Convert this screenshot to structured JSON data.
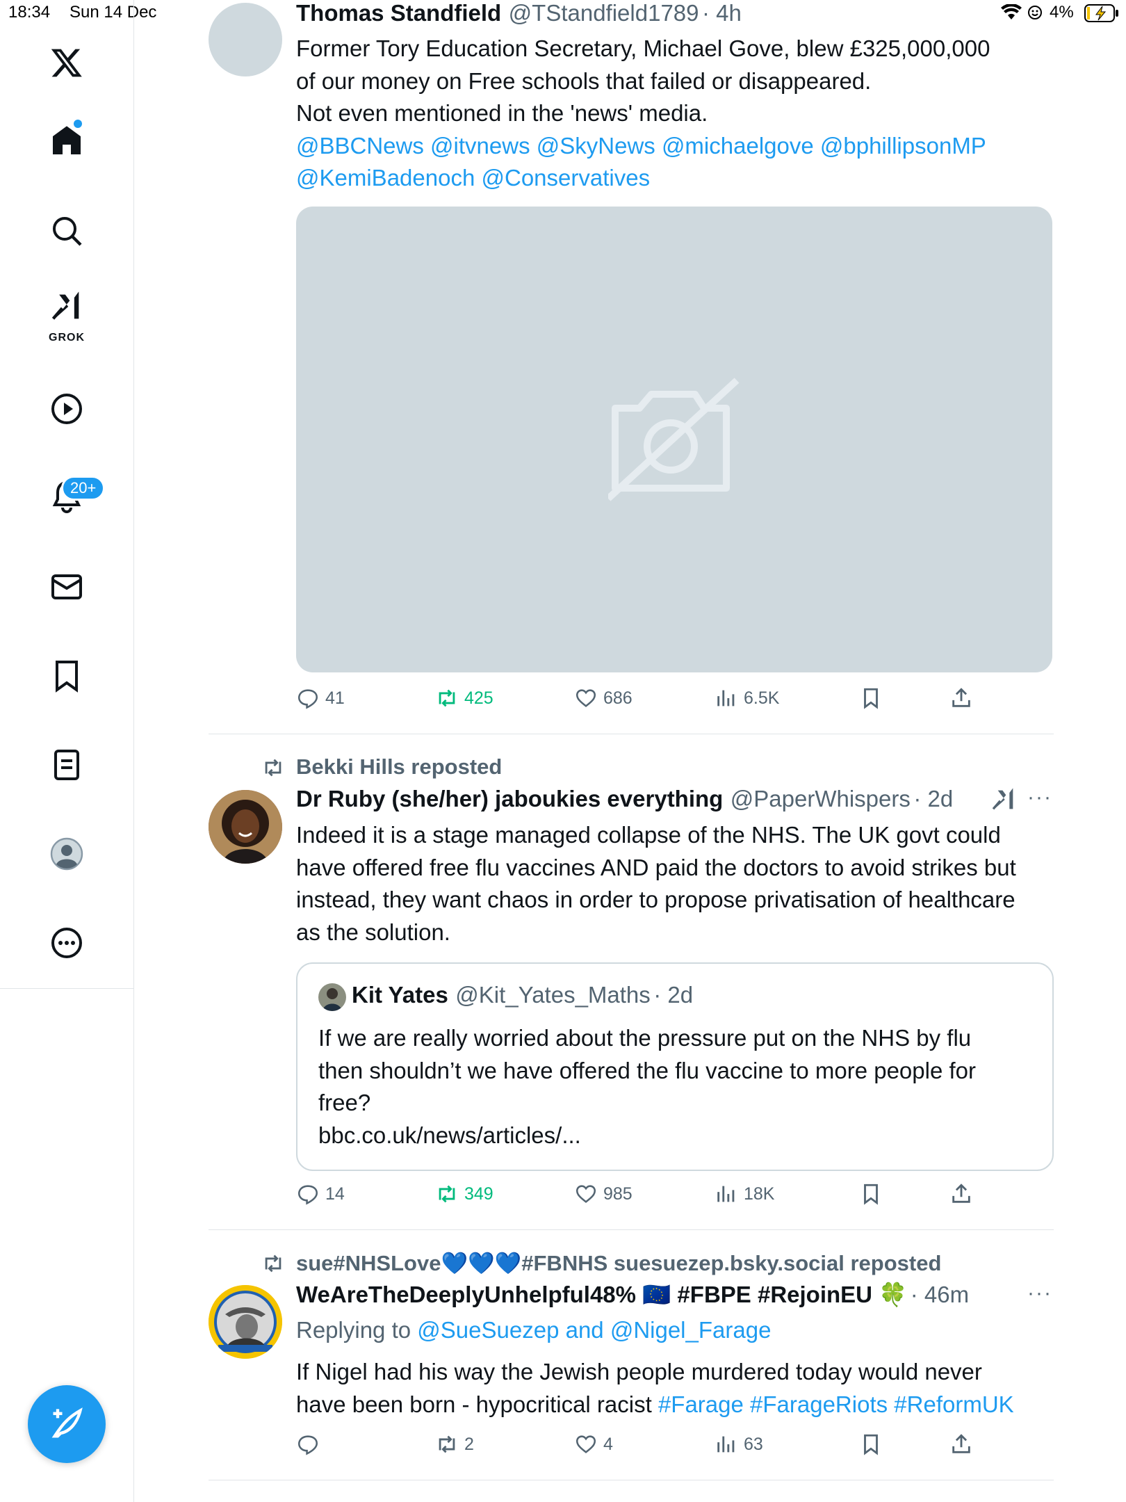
{
  "status_bar": {
    "time": "18:34",
    "date": "Sun 14 Dec",
    "battery": "4%"
  },
  "sidebar": {
    "grok_label": "GROK",
    "notifications_badge": "20+"
  },
  "tweets": [
    {
      "author": "Thomas Standfield",
      "handle": "@TStandfield1789",
      "time": "· 4h",
      "lines": [
        "Former Tory Education Secretary, Michael Gove, blew £325,000,000",
        "of our money on Free schools that failed or disappeared.",
        "Not even mentioned in the 'news' media."
      ],
      "mentions_line1": "@BBCNews @itvnews @SkyNews @michaelgove @bphillipsonMP",
      "mentions_line2": "@KemiBadenoch @Conservatives",
      "replies": "41",
      "reposts": "425",
      "likes": "686",
      "views": "6.5K"
    },
    {
      "social_context": "Bekki Hills reposted",
      "author": "Dr Ruby (she/her) jaboukies everything",
      "handle": "@PaperWhispers",
      "time": "· 2d",
      "lines": [
        "Indeed it is a stage managed collapse of the NHS. The UK govt could",
        "have offered free flu vaccines AND paid the doctors to avoid strikes but",
        "instead, they want chaos in order to propose privatisation of healthcare",
        "as the solution."
      ],
      "quote": {
        "author": "Kit Yates",
        "handle": "@Kit_Yates_Maths",
        "time": "· 2d",
        "lines": [
          "If we are really worried about the pressure put on the NHS by flu",
          "then shouldn’t we have offered the flu vaccine to more people for",
          "free?",
          "bbc.co.uk/news/articles/..."
        ]
      },
      "replies": "14",
      "reposts": "349",
      "likes": "985",
      "views": "18K"
    },
    {
      "social_context": "sue#NHSLove💙💙💙#FBNHS suesuezep.bsky.social reposted",
      "author": "WeAreTheDeeplyUnhelpful48% 🇪🇺 #FBPE #RejoinEU 🍀",
      "time": "· 46m",
      "replying_prefix": "Replying to",
      "replying_to": "@SueSuezep and @Nigel_Farage",
      "line1": "If Nigel had his way the Jewish people murdered today would never",
      "line2_text": "have been born - hypocritical racist",
      "line2_tags": "#Farage #FarageRiots #ReformUK",
      "replies": "",
      "reposts": "2",
      "likes": "4",
      "views": "63"
    }
  ]
}
